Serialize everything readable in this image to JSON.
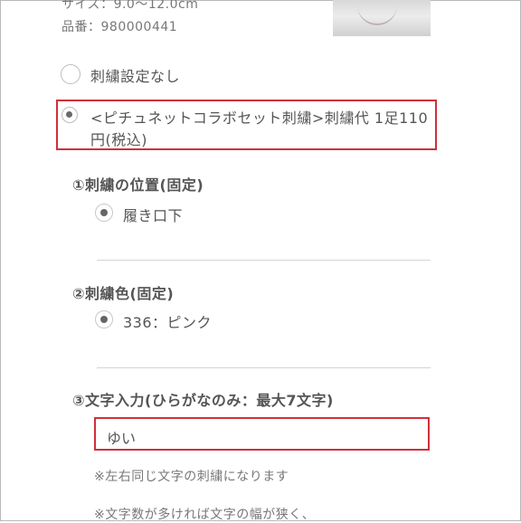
{
  "product": {
    "size_text": "サイズ：9.0〜12.0cm",
    "code_text": "品番：980000441"
  },
  "embroidery_options": [
    {
      "label": "刺繍設定なし",
      "selected": false
    },
    {
      "label_line1": "<ピチュネットコラボセット刺繍>刺繍代 1足110",
      "label_line2": "円(税込)",
      "selected": true
    }
  ],
  "sections": {
    "position": {
      "title": "①刺繍の位置(固定)",
      "option": "履き口下"
    },
    "color": {
      "title": "②刺繍色(固定)",
      "option": "336：ピンク"
    },
    "text": {
      "title": "③文字入力(ひらがなのみ：最大7文字)",
      "input_value": "ゆい"
    }
  },
  "notes": {
    "note1": "※左右同じ文字の刺繍になります",
    "note2": "※文字数が多ければ文字の幅が狭く、"
  },
  "colors": {
    "highlight": "#d0303a",
    "text": "#555555"
  }
}
